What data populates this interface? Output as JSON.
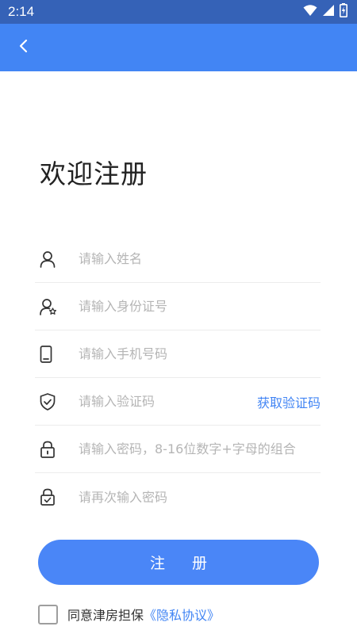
{
  "status_bar": {
    "time": "2:14",
    "icons": [
      "wifi-icon",
      "signal-icon",
      "battery-charging-icon"
    ]
  },
  "app_bar": {
    "back_icon": "chevron-left-icon",
    "color": "#4285f4"
  },
  "page": {
    "title": "欢迎注册"
  },
  "form": {
    "fields": [
      {
        "name": "name",
        "icon": "user-icon",
        "placeholder": "请输入姓名",
        "value": ""
      },
      {
        "name": "id-number",
        "icon": "user-id-icon",
        "placeholder": "请输入身份证号",
        "value": ""
      },
      {
        "name": "phone",
        "icon": "phone-icon",
        "placeholder": "请输入手机号码",
        "value": ""
      },
      {
        "name": "verification-code",
        "icon": "shield-check-icon",
        "placeholder": "请输入验证码",
        "value": ""
      },
      {
        "name": "password",
        "icon": "lock-icon",
        "placeholder": "请输入密码，8-16位数字+字母的组合",
        "value": ""
      },
      {
        "name": "confirm-password",
        "icon": "lock-check-icon",
        "placeholder": "请再次输入密码",
        "value": ""
      }
    ],
    "get_code_label": "获取验证码"
  },
  "register_button": {
    "label": "注 册"
  },
  "agreement": {
    "checked": false,
    "text": "同意津房担保",
    "link_text": "《隐私协议》"
  },
  "colors": {
    "status_bar": "#3562b7",
    "primary": "#4285f4",
    "button": "#4a86f7",
    "placeholder": "#b5b5b5"
  }
}
